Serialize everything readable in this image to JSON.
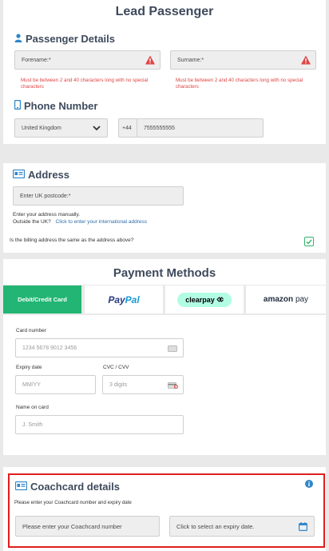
{
  "lead": {
    "title": "Lead Passenger",
    "passenger_details": "Passenger Details",
    "forename_placeholder": "Forename:*",
    "surname_placeholder": "Surname:*",
    "forename_error": "Must be between 2 and 40 characters long with no special characters",
    "surname_error": "Must be between 2 and 40 characters long with no special characters",
    "phone_title": "Phone Number",
    "country": "United Kingdom",
    "dial_code": "+44",
    "phone_value": "7555555555"
  },
  "address": {
    "title": "Address",
    "postcode_placeholder": "Enter UK postcode:*",
    "manual_link": "Enter your address manually.",
    "outside_label": "Outside the UK?",
    "international_link": "Click to enter your international address",
    "billing_question": "Is the billing address the same as the address above?",
    "billing_same": true
  },
  "payment": {
    "title": "Payment Methods",
    "tabs": {
      "card": "Debit/Credit Card",
      "paypal_pay": "Pay",
      "paypal_pal": "Pal",
      "clearpay": "clearpay",
      "amazon": "amazon",
      "amazon_pay": "pay"
    },
    "card_number_label": "Card number",
    "card_number_placeholder": "1234 5678 9012 3456",
    "expiry_label": "Expiry date",
    "expiry_placeholder": "MM/YY",
    "cvc_label": "CVC / CVV",
    "cvc_placeholder": "3 digits",
    "name_label": "Name on card",
    "name_placeholder": "J. Smith"
  },
  "coachcard": {
    "title": "Coachcard details",
    "instructions": "Please enter your Coachcard number and expiry date",
    "number_placeholder": "Please enter your Coachcard number",
    "expiry_placeholder": "Click to select an expiry date."
  },
  "colors": {
    "brand_green": "#22b573",
    "accent_blue": "#2f86c9",
    "error_red": "#e04444",
    "highlight_red": "#e01e1e",
    "heading": "#3e4a5c"
  }
}
